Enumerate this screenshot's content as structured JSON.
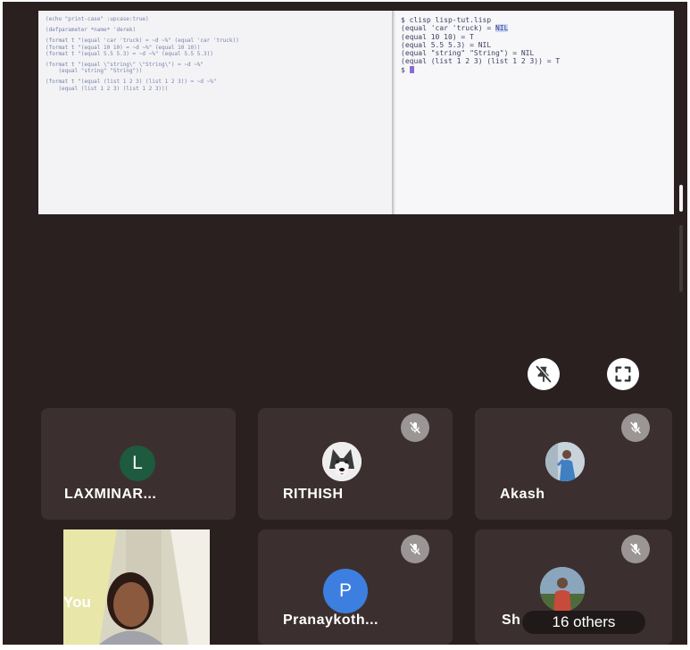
{
  "presentation": {
    "editor_lines": [
      "(echo \"print-case\" :upcase:true)",
      "(defparameter *name* 'derek)",
      "(format t \"(equal 'car 'truck) = ~d ~%\" (equal 'car 'truck))",
      "(format t \"(equal 10 10) = ~d ~%\" (equal 10 10))",
      "(format t \"(equal 5.5 5.3) = ~d ~%\" (equal 5.5 5.3))",
      "(format t \"(equal \\\"string\\\" \\\"String\\\") = ~d ~%\"",
      "    (equal \"string\" \"String\"))",
      "(format t \"(equal (list 1 2 3) (list 1 2 3)) = ~d ~%\"",
      "    (equal (list 1 2 3) (list 1 2 3)))"
    ],
    "terminal": {
      "command": "$ clisp lisp-tut.lisp",
      "line1_prefix": "(equal 'car 'truck) = ",
      "line1_result": "NIL",
      "lines": [
        "(equal 10 10) = T",
        "(equal 5.5 5.3) = NIL",
        "(equal \"string\" \"String\") = NIL",
        "(equal (list 1 2 3) (list 1 2 3)) = T"
      ],
      "prompt": "$ "
    }
  },
  "controls": {
    "unpin_icon": "pin-off-icon",
    "fullscreen_icon": "fullscreen-icon"
  },
  "participants": [
    {
      "name": "LAXMINAR...",
      "avatar_letter": "L",
      "avatar_color": "#1e5a3e",
      "muted": false
    },
    {
      "name": "RITHISH",
      "avatar": "husky-photo",
      "muted": true
    },
    {
      "name": "Akash",
      "avatar": "person-photo",
      "muted": true
    },
    {
      "name": "Pranaykoth...",
      "avatar_letter": "P",
      "avatar_color": "#3d7fe0",
      "muted": true
    },
    {
      "name": "Sh",
      "avatar": "person-photo",
      "muted": true
    }
  ],
  "self": {
    "name": "You"
  },
  "others": {
    "label": "16 others"
  },
  "colors": {
    "background": "#2a201f",
    "tile": "#3b302f",
    "mute_badge": "#9b9595"
  }
}
